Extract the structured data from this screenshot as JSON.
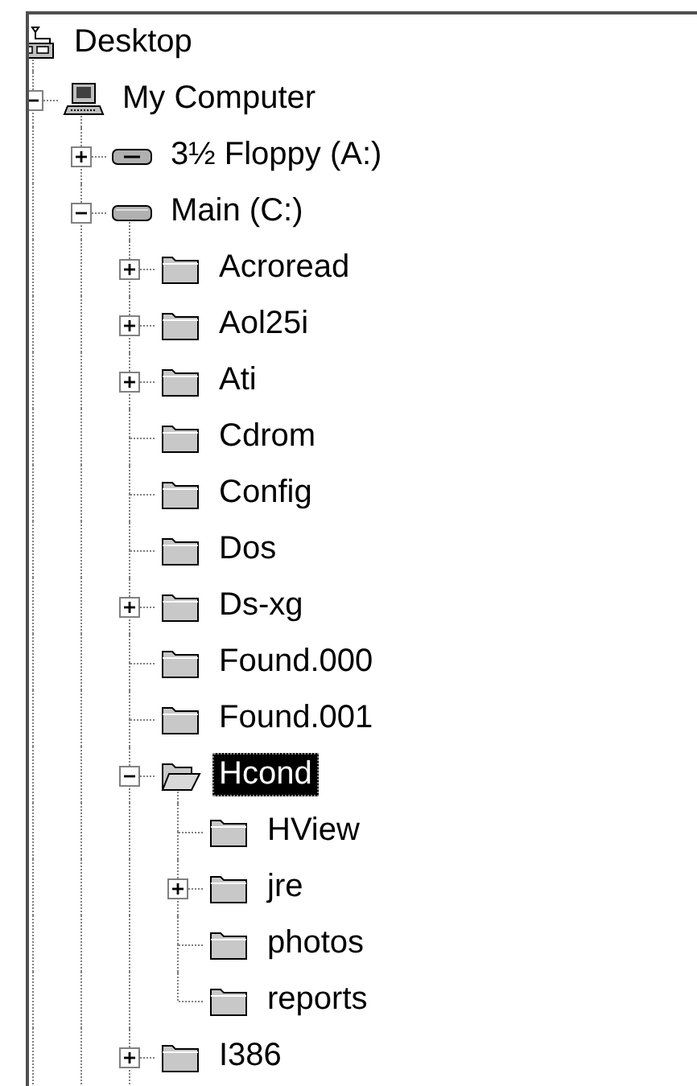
{
  "tree": {
    "label": "Desktop",
    "kind": "desktop",
    "selected": false,
    "children": [
      {
        "label": "My Computer",
        "kind": "computer",
        "selected": false,
        "expanded": true,
        "children": [
          {
            "label": "3½ Floppy (A:)",
            "kind": "floppy",
            "selected": false,
            "expanded": false
          },
          {
            "label": "Main (C:)",
            "kind": "drive",
            "selected": false,
            "expanded": true,
            "children": [
              {
                "label": "Acroread",
                "kind": "folder",
                "selected": false,
                "expanded": false
              },
              {
                "label": "Aol25i",
                "kind": "folder",
                "selected": false,
                "expanded": false
              },
              {
                "label": "Ati",
                "kind": "folder",
                "selected": false,
                "expanded": false
              },
              {
                "label": "Cdrom",
                "kind": "folder",
                "selected": false
              },
              {
                "label": "Config",
                "kind": "folder",
                "selected": false
              },
              {
                "label": "Dos",
                "kind": "folder",
                "selected": false
              },
              {
                "label": "Ds-xg",
                "kind": "folder",
                "selected": false,
                "expanded": false
              },
              {
                "label": "Found.000",
                "kind": "folder",
                "selected": false
              },
              {
                "label": "Found.001",
                "kind": "folder",
                "selected": false
              },
              {
                "label": "Hcond",
                "kind": "folder",
                "selected": true,
                "expanded": true,
                "children": [
                  {
                    "label": "HView",
                    "kind": "folder",
                    "selected": false
                  },
                  {
                    "label": "jre",
                    "kind": "folder",
                    "selected": false,
                    "expanded": false
                  },
                  {
                    "label": "photos",
                    "kind": "folder",
                    "selected": false
                  },
                  {
                    "label": "reports",
                    "kind": "folder",
                    "selected": false
                  }
                ]
              },
              {
                "label": "I386",
                "kind": "folder",
                "selected": false,
                "expanded": false
              }
            ]
          }
        ]
      }
    ]
  }
}
